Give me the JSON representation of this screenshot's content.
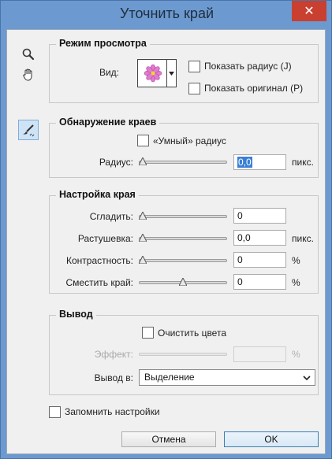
{
  "window": {
    "title": "Уточнить край",
    "close_glyph": "✕"
  },
  "tools": [
    "zoom-icon",
    "hand-icon",
    "refine-radius-brush-icon"
  ],
  "view_mode": {
    "title": "Режим просмотра",
    "view_label": "Вид:",
    "show_radius_label": "Показать радиус (J)",
    "show_original_label": "Показать оригинал (P)",
    "show_radius_checked": false,
    "show_original_checked": false
  },
  "edge_detection": {
    "title": "Обнаружение краев",
    "smart_radius_label": "«Умный» радиус",
    "smart_radius_checked": false,
    "radius_label": "Радиус:",
    "radius_value": "0,0",
    "radius_unit": "пикс.",
    "radius_slider_fraction": 0
  },
  "adjust_edge": {
    "title": "Настройка края",
    "smooth_label": "Сгладить:",
    "smooth_value": "0",
    "smooth_slider_fraction": 0,
    "feather_label": "Растушевка:",
    "feather_value": "0,0",
    "feather_unit": "пикс.",
    "feather_slider_fraction": 0,
    "contrast_label": "Контрастность:",
    "contrast_value": "0",
    "contrast_unit": "%",
    "contrast_slider_fraction": 0,
    "shift_label": "Сместить край:",
    "shift_value": "0",
    "shift_unit": "%",
    "shift_slider_fraction": 0.5
  },
  "output": {
    "title": "Вывод",
    "decontaminate_label": "Очистить цвета",
    "decontaminate_checked": false,
    "amount_label": "Эффект:",
    "amount_value": "",
    "amount_unit": "%",
    "output_to_label": "Вывод в:",
    "output_to_value": "Выделение"
  },
  "remember_settings_label": "Запомнить настройки",
  "remember_settings_checked": false,
  "buttons": {
    "cancel": "Отмена",
    "ok": "OK"
  },
  "colors": {
    "titlebar": "#6c9ad0",
    "close": "#c94030",
    "selection": "#3a7fd5"
  }
}
